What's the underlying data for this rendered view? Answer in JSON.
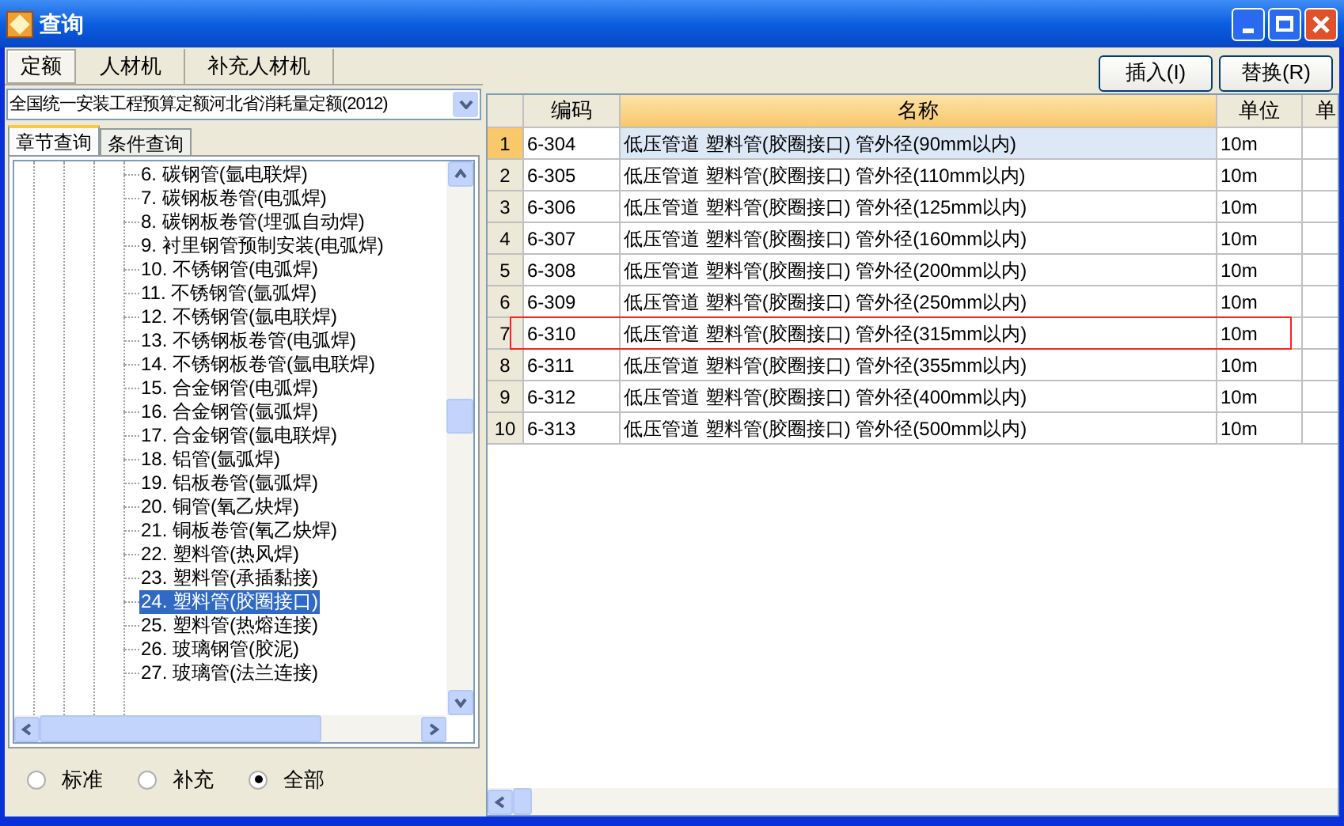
{
  "window": {
    "title": "查询"
  },
  "tabs": [
    {
      "label": "定额",
      "selected": true
    },
    {
      "label": "人材机",
      "selected": false
    },
    {
      "label": "补充人材机",
      "selected": false
    }
  ],
  "library_select": {
    "value": "全国统一安装工程预算定额河北省消耗量定额(2012)"
  },
  "search_tabs": [
    {
      "label": "章节查询",
      "selected": true
    },
    {
      "label": "条件查询",
      "selected": false
    }
  ],
  "tree": {
    "items": [
      {
        "label": "6. 碳钢管(氩电联焊)",
        "selected": false
      },
      {
        "label": "7. 碳钢板卷管(电弧焊)",
        "selected": false
      },
      {
        "label": "8. 碳钢板卷管(埋弧自动焊)",
        "selected": false
      },
      {
        "label": "9. 衬里钢管预制安装(电弧焊)",
        "selected": false
      },
      {
        "label": "10. 不锈钢管(电弧焊)",
        "selected": false
      },
      {
        "label": "11. 不锈钢管(氩弧焊)",
        "selected": false
      },
      {
        "label": "12. 不锈钢管(氩电联焊)",
        "selected": false
      },
      {
        "label": "13. 不锈钢板卷管(电弧焊)",
        "selected": false
      },
      {
        "label": "14. 不锈钢板卷管(氩电联焊)",
        "selected": false
      },
      {
        "label": "15. 合金钢管(电弧焊)",
        "selected": false
      },
      {
        "label": "16. 合金钢管(氩弧焊)",
        "selected": false
      },
      {
        "label": "17. 合金钢管(氩电联焊)",
        "selected": false
      },
      {
        "label": "18. 铝管(氩弧焊)",
        "selected": false
      },
      {
        "label": "19. 铝板卷管(氩弧焊)",
        "selected": false
      },
      {
        "label": "20. 铜管(氧乙炔焊)",
        "selected": false
      },
      {
        "label": "21. 铜板卷管(氧乙炔焊)",
        "selected": false
      },
      {
        "label": "22. 塑料管(热风焊)",
        "selected": false
      },
      {
        "label": "23. 塑料管(承插黏接)",
        "selected": false
      },
      {
        "label": "24. 塑料管(胶圈接口)",
        "selected": true
      },
      {
        "label": "25. 塑料管(热熔连接)",
        "selected": false
      },
      {
        "label": "26. 玻璃钢管(胶泥)",
        "selected": false
      },
      {
        "label": "27. 玻璃管(法兰连接)",
        "selected": false
      }
    ]
  },
  "filter_options": [
    {
      "label": "标准",
      "selected": false
    },
    {
      "label": "补充",
      "selected": false
    },
    {
      "label": "全部",
      "selected": true
    }
  ],
  "buttons": [
    {
      "label": "插入(I)"
    },
    {
      "label": "替换(R)"
    }
  ],
  "table": {
    "columns": [
      "编码",
      "名称",
      "单位",
      "单"
    ],
    "rows": [
      {
        "number": "1",
        "code": "6-304",
        "name": "低压管道 塑料管(胶圈接口) 管外径(90mm以内)",
        "unit": "10m",
        "current": true,
        "marked": false
      },
      {
        "number": "2",
        "code": "6-305",
        "name": "低压管道 塑料管(胶圈接口) 管外径(110mm以内)",
        "unit": "10m",
        "current": false,
        "marked": false
      },
      {
        "number": "3",
        "code": "6-306",
        "name": "低压管道 塑料管(胶圈接口) 管外径(125mm以内)",
        "unit": "10m",
        "current": false,
        "marked": false
      },
      {
        "number": "4",
        "code": "6-307",
        "name": "低压管道 塑料管(胶圈接口) 管外径(160mm以内)",
        "unit": "10m",
        "current": false,
        "marked": false
      },
      {
        "number": "5",
        "code": "6-308",
        "name": "低压管道 塑料管(胶圈接口) 管外径(200mm以内)",
        "unit": "10m",
        "current": false,
        "marked": false
      },
      {
        "number": "6",
        "code": "6-309",
        "name": "低压管道 塑料管(胶圈接口) 管外径(250mm以内)",
        "unit": "10m",
        "current": false,
        "marked": false
      },
      {
        "number": "7",
        "code": "6-310",
        "name": "低压管道 塑料管(胶圈接口) 管外径(315mm以内)",
        "unit": "10m",
        "current": false,
        "marked": true
      },
      {
        "number": "8",
        "code": "6-311",
        "name": "低压管道 塑料管(胶圈接口) 管外径(355mm以内)",
        "unit": "10m",
        "current": false,
        "marked": false
      },
      {
        "number": "9",
        "code": "6-312",
        "name": "低压管道 塑料管(胶圈接口) 管外径(400mm以内)",
        "unit": "10m",
        "current": false,
        "marked": false
      },
      {
        "number": "10",
        "code": "6-313",
        "name": "低压管道 塑料管(胶圈接口) 管外径(500mm以内)",
        "unit": "10m",
        "current": false,
        "marked": false
      }
    ]
  }
}
